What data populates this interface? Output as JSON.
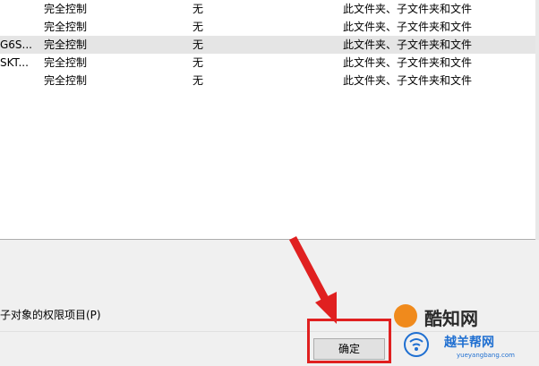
{
  "permission_rows": [
    {
      "principal": "",
      "access": "完全控制",
      "inherited_from": "无",
      "applies_to": "此文件夹、子文件夹和文件",
      "selected": false
    },
    {
      "principal": "",
      "access": "完全控制",
      "inherited_from": "无",
      "applies_to": "此文件夹、子文件夹和文件",
      "selected": false
    },
    {
      "principal": "G6S...",
      "access": "完全控制",
      "inherited_from": "无",
      "applies_to": "此文件夹、子文件夹和文件",
      "selected": true
    },
    {
      "principal": "SKT...",
      "access": "完全控制",
      "inherited_from": "无",
      "applies_to": "此文件夹、子文件夹和文件",
      "selected": false
    },
    {
      "principal": "",
      "access": "完全控制",
      "inherited_from": "无",
      "applies_to": "此文件夹、子文件夹和文件",
      "selected": false
    }
  ],
  "replace_child_label": "子对象的权限项目(P)",
  "ok_label": "确定",
  "watermark": {
    "top_name": "酷知网",
    "bottom_name": "越羊帮网",
    "url": "yueyangbang.com"
  },
  "colors": {
    "highlight": "#e02020",
    "selected_row": "#e5e5e5",
    "watermark_blue": "#1f6fd1",
    "watermark_orange": "#f08a1c"
  }
}
